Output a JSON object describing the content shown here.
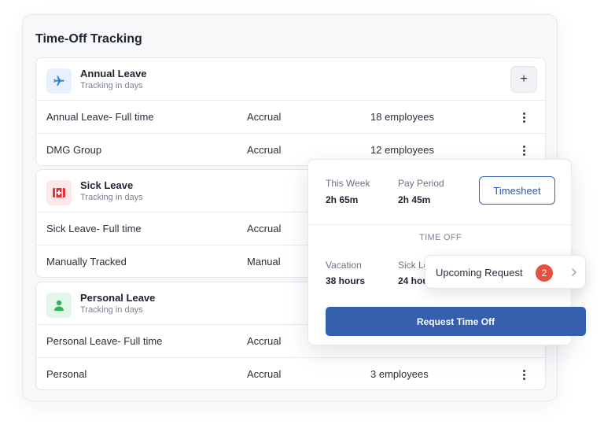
{
  "title": "Time-Off Tracking",
  "add_label": "+",
  "groups": [
    {
      "name": "Annual Leave",
      "subtitle": "Tracking in days",
      "icon": "airplane-icon",
      "rows": [
        {
          "name": "Annual Leave- Full time",
          "method": "Accrual",
          "employees": "18 employees"
        },
        {
          "name": "DMG Group",
          "method": "Accrual",
          "employees": "12 employees"
        }
      ]
    },
    {
      "name": "Sick Leave",
      "subtitle": "Tracking in days",
      "icon": "medical-kit-icon",
      "rows": [
        {
          "name": "Sick Leave- Full time",
          "method": "Accrual"
        },
        {
          "name": "Manually Tracked",
          "method": "Manual"
        }
      ]
    },
    {
      "name": "Personal Leave",
      "subtitle": "Tracking in days",
      "icon": "person-icon",
      "rows": [
        {
          "name": "Personal Leave- Full time",
          "method": "Accrual"
        },
        {
          "name": "Personal",
          "method": "Accrual",
          "employees": "3 employees"
        }
      ]
    }
  ],
  "popup": {
    "this_week_label": "This Week",
    "this_week_value": "2h 65m",
    "pay_period_label": "Pay Period",
    "pay_period_value": "2h 45m",
    "timesheet_label": "Timesheet",
    "section_label": "TIME OFF",
    "vacation_label": "Vacation",
    "vacation_value": "38 hours",
    "sick_label": "Sick Le",
    "sick_value": "24 hou",
    "request_label": "Request Time Off"
  },
  "upcoming": {
    "label": "Upcoming Request",
    "count": "2"
  },
  "colors": {
    "accent": "#3460ad",
    "badge": "#e5513e",
    "plane_icon": "#2f7de1",
    "medical_icon": "#e0343a",
    "person_icon": "#2fb35a"
  }
}
